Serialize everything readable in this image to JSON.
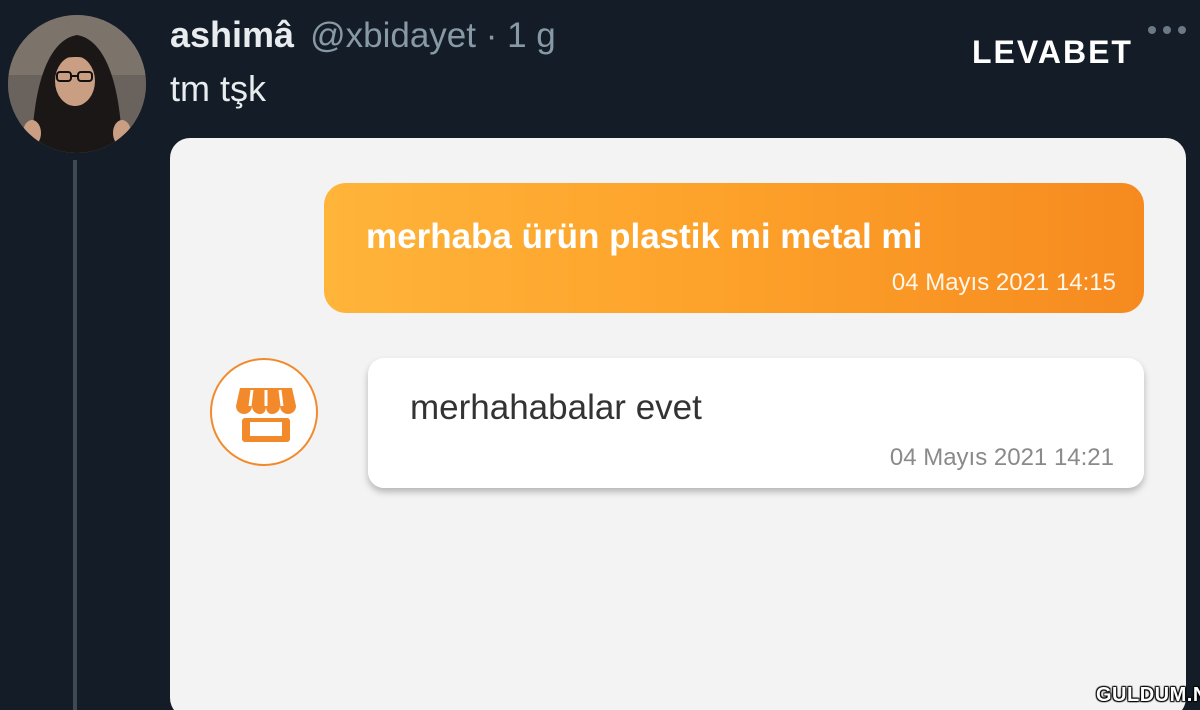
{
  "tweet": {
    "display_name": "ashimâ",
    "handle_time": "@xbidayet · 1 g",
    "text": "tm tşk"
  },
  "brand_logo": "LEVABET",
  "chat": {
    "outgoing": {
      "text": "merhaba ürün plastik mi metal mi",
      "timestamp": "04 Mayıs 2021 14:15"
    },
    "incoming": {
      "text": "merhahabalar evet",
      "timestamp": "04 Mayıs 2021 14:21",
      "avatar_icon": "store-icon"
    }
  },
  "watermark": "GULDUM.NET",
  "colors": {
    "background": "#141d27",
    "outgoing_bubble": "#fda12a",
    "store_accent": "#f28a2c"
  }
}
